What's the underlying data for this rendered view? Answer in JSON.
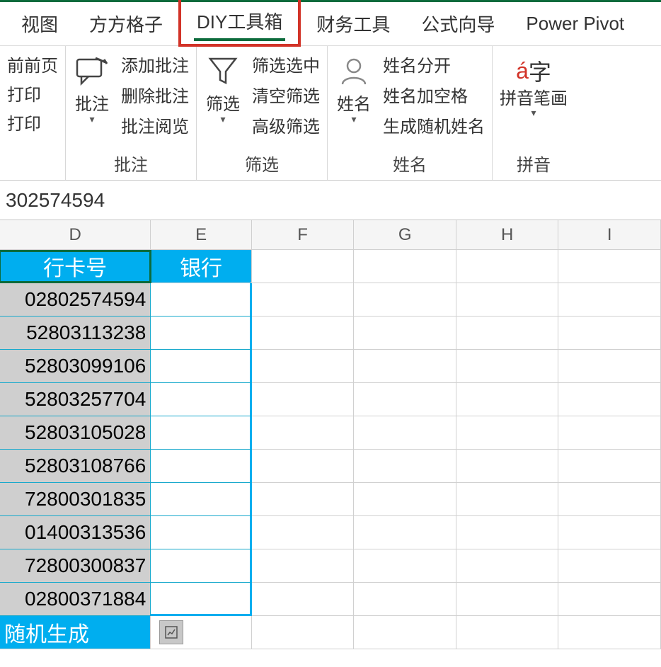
{
  "menu": {
    "view": "视图",
    "fangfang": "方方格子",
    "diy": "DIY工具箱",
    "finance": "财务工具",
    "formula": "公式向导",
    "pivot": "Power Pivot"
  },
  "left_group": {
    "item1": "前前页",
    "item2": "打印",
    "item3": "打印"
  },
  "annot": {
    "big_label": "批注",
    "add": "添加批注",
    "del": "删除批注",
    "review": "批注阅览",
    "group_label": "批注"
  },
  "filter": {
    "big_label": "筛选",
    "select": "筛选选中",
    "clear": "清空筛选",
    "adv": "高级筛选",
    "group_label": "筛选"
  },
  "name": {
    "big_label": "姓名",
    "split": "姓名分开",
    "space": "姓名加空格",
    "gen": "生成随机姓名",
    "group_label": "姓名"
  },
  "pinyin": {
    "big_label": "拼音笔画",
    "group_label": "拼音"
  },
  "formula_bar": {
    "value": "302574594"
  },
  "cols": {
    "D": "D",
    "E": "E",
    "F": "F",
    "G": "G",
    "H": "H",
    "I": "I"
  },
  "headers": {
    "card": "行卡号",
    "bank": "银行"
  },
  "rows": [
    "02802574594",
    "52803113238",
    "52803099106",
    "52803257704",
    "52803105028",
    "52803108766",
    "72800301835",
    "01400313536",
    "72800300837",
    "02800371884"
  ],
  "footer": {
    "label": "随机生成"
  }
}
